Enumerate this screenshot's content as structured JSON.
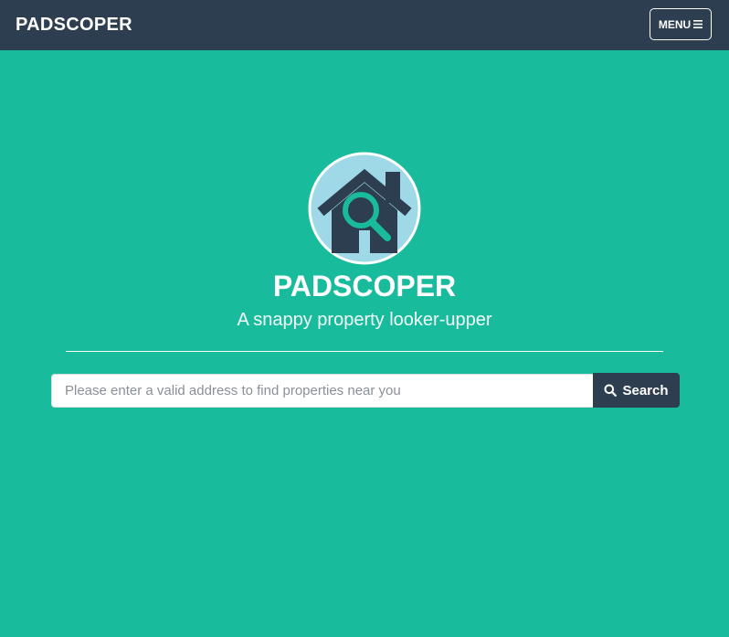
{
  "navbar": {
    "brand": "PADSCOPER",
    "menu_label": "MENU",
    "menu_icon": "hamburger-icon"
  },
  "hero": {
    "logo_icon": "house-magnifier-logo",
    "title": "PADSCOPER",
    "tagline": "A snappy property looker-upper"
  },
  "search": {
    "placeholder": "Please enter a valid address to find properties near you",
    "value": "",
    "button_label": "Search",
    "button_icon": "search-icon"
  },
  "colors": {
    "background": "#18BC9C",
    "navbar": "#2C3E50",
    "logo_circle": "#9FD9E8",
    "accent": "#18BC9C"
  }
}
